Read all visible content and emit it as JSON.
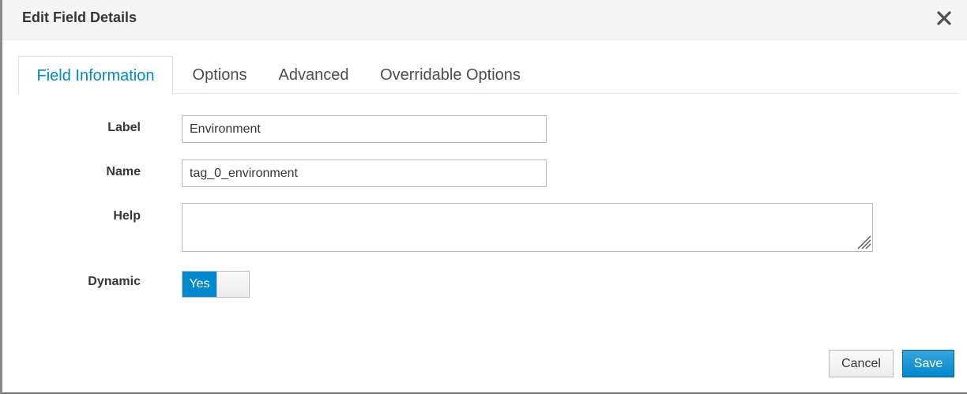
{
  "modal": {
    "title": "Edit Field Details"
  },
  "tabs": [
    {
      "label": "Field Information",
      "active": true
    },
    {
      "label": "Options",
      "active": false
    },
    {
      "label": "Advanced",
      "active": false
    },
    {
      "label": "Overridable Options",
      "active": false
    }
  ],
  "form": {
    "label": {
      "label": "Label",
      "value": "Environment"
    },
    "name": {
      "label": "Name",
      "value": "tag_0_environment"
    },
    "help": {
      "label": "Help",
      "value": ""
    },
    "dynamic": {
      "label": "Dynamic",
      "toggle_text": "Yes",
      "checked": true
    }
  },
  "footer": {
    "cancel_label": "Cancel",
    "save_label": "Save"
  },
  "colors": {
    "accent": "#0088ce",
    "header_bg": "#f5f5f5",
    "text": "#363636"
  },
  "icons": {
    "close": "close-icon",
    "resize": "resize-grip-icon"
  }
}
